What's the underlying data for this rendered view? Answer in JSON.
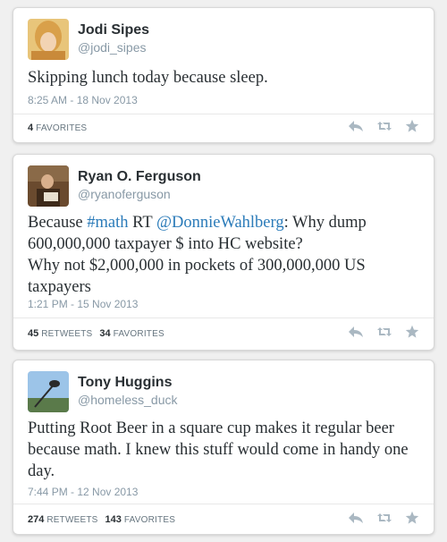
{
  "tweets": [
    {
      "name": "Jodi Sipes",
      "handle": "@jodi_sipes",
      "text": "Skipping lunch today because sleep.",
      "time": "8:25 AM - 18 Nov 2013",
      "favorites_count": "4",
      "favorites_label": "FAVORITES"
    },
    {
      "name": "Ryan O. Ferguson",
      "handle": "@ryanoferguson",
      "text_pre": "Because ",
      "hashtag": "#math",
      "text_mid": " RT ",
      "mention": "@DonnieWahlberg",
      "text_line1_end": ": Why dump 600,000,000 taxpayer $ into HC website?",
      "text_line2": "Why not $2,000,000 in pockets of 300,000,000 US taxpayers",
      "time": "1:21 PM - 15 Nov 2013",
      "retweets_count": "45",
      "retweets_label": "RETWEETS",
      "favorites_count": "34",
      "favorites_label": "FAVORITES"
    },
    {
      "name": "Tony Huggins",
      "handle": "@homeless_duck",
      "text": "Putting Root Beer in a square cup makes it regular beer because math. I knew this stuff would come in handy one day.",
      "time": "7:44 PM - 12 Nov 2013",
      "retweets_count": "274",
      "retweets_label": "RETWEETS",
      "favorites_count": "143",
      "favorites_label": "FAVORITES"
    }
  ],
  "icons": {
    "reply": "reply-icon",
    "retweet": "retweet-icon",
    "favorite": "star-icon"
  },
  "colors": {
    "link": "#2b7bb9",
    "muted": "#8899a6",
    "icon": "#aab8c2"
  }
}
